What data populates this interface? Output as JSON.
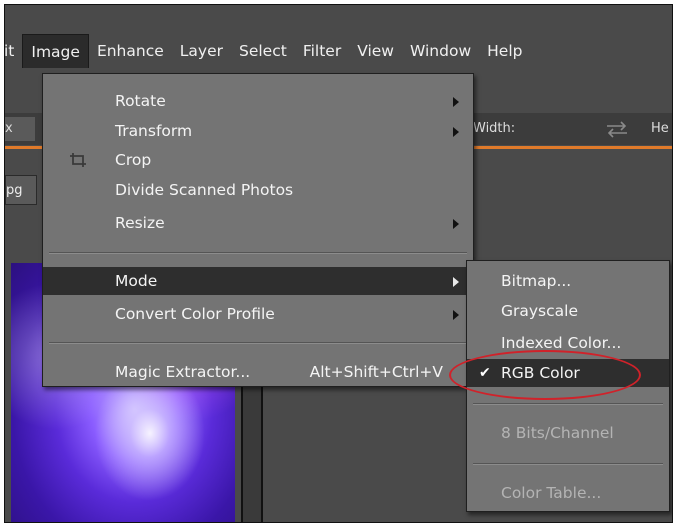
{
  "menubar": {
    "items": [
      {
        "label": "it"
      },
      {
        "label": "Image"
      },
      {
        "label": "Enhance"
      },
      {
        "label": "Layer"
      },
      {
        "label": "Select"
      },
      {
        "label": "Filter"
      },
      {
        "label": "View"
      },
      {
        "label": "Window"
      },
      {
        "label": "Help"
      }
    ],
    "active": "Image"
  },
  "optionsbar": {
    "x_label": "x",
    "width_label": "Width:",
    "height_label": "He"
  },
  "document": {
    "tab_label": "pg"
  },
  "image_menu": {
    "items": [
      {
        "label": "Rotate",
        "submenu": true
      },
      {
        "label": "Transform",
        "submenu": true
      },
      {
        "label": "Crop",
        "icon": "crop-icon"
      },
      {
        "label": "Divide Scanned Photos"
      },
      {
        "label": "Resize",
        "submenu": true
      },
      {
        "label": "Mode",
        "submenu": true,
        "highlighted": true
      },
      {
        "label": "Convert Color Profile",
        "submenu": true
      },
      {
        "label": "Magic Extractor...",
        "shortcut": "Alt+Shift+Ctrl+V"
      }
    ]
  },
  "mode_submenu": {
    "items": [
      {
        "label": "Bitmap...",
        "enabled": true
      },
      {
        "label": "Grayscale",
        "enabled": true
      },
      {
        "label": "Indexed Color...",
        "enabled": true
      },
      {
        "label": "RGB Color",
        "enabled": true,
        "checked": true,
        "highlighted": true
      },
      {
        "label": "8 Bits/Channel",
        "enabled": false
      },
      {
        "label": "Color Table...",
        "enabled": false
      }
    ]
  },
  "colors": {
    "accent_orange": "#e07a2a",
    "annotation_red": "#d0222a",
    "menu_bg": "#747474",
    "menu_highlight": "#2e2e2e"
  }
}
